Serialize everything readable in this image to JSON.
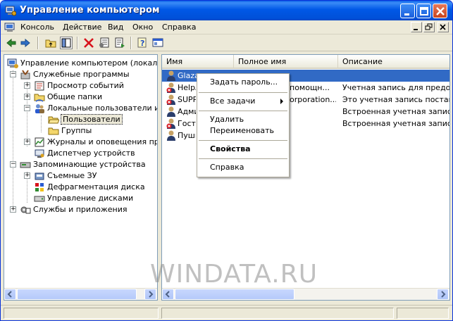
{
  "window": {
    "title": "Управление компьютером"
  },
  "menubar": {
    "items": [
      "Консоль",
      "Действие",
      "Вид",
      "Окно",
      "Справка"
    ]
  },
  "toolbar": {
    "buttons": [
      "back-icon",
      "forward-icon",
      "up-folder-icon",
      "show-tree-icon",
      "delete-icon",
      "properties-icon",
      "export-icon",
      "help-icon",
      "mmc-icon"
    ]
  },
  "tree": {
    "items": [
      "Управление компьютером (локальны",
      "Служебные программы",
      "Просмотр событий",
      "Общие папки",
      "Локальные пользователи и гр",
      "Пользователи",
      "Группы",
      "Журналы и оповещения произ",
      "Диспетчер устройств",
      "Запоминающие устройства",
      "Съемные ЗУ",
      "Дефрагментация диска",
      "Управление дисками",
      "Службы и приложения"
    ]
  },
  "list": {
    "columns": [
      "Имя",
      "Полное имя",
      "Описание"
    ],
    "rows": [
      {
        "name": "Glaza",
        "fullname": "",
        "description": ""
      },
      {
        "name": "HelpA",
        "fullname": "помощн...",
        "description": "Учетная запись для предоста"
      },
      {
        "name": "SUPPO",
        "fullname": "orporation...",
        "description": "Это учетная запись поставщи"
      },
      {
        "name": "Адми",
        "fullname": "",
        "description": "Встроенная учетная запись ад"
      },
      {
        "name": "Гость",
        "fullname": "",
        "description": "Встроенная учетная запись д"
      },
      {
        "name": "Пуши",
        "fullname": "",
        "description": ""
      }
    ]
  },
  "context_menu": {
    "set_password": "Задать пароль...",
    "all_tasks": "Все задачи",
    "delete": "Удалить",
    "rename": "Переименовать",
    "properties": "Свойства",
    "help": "Справка"
  },
  "watermark": "WINDATA.RU",
  "colors": {
    "title_bar": "#0058e6",
    "selection": "#316ac5",
    "window_face": "#ece9d8"
  }
}
